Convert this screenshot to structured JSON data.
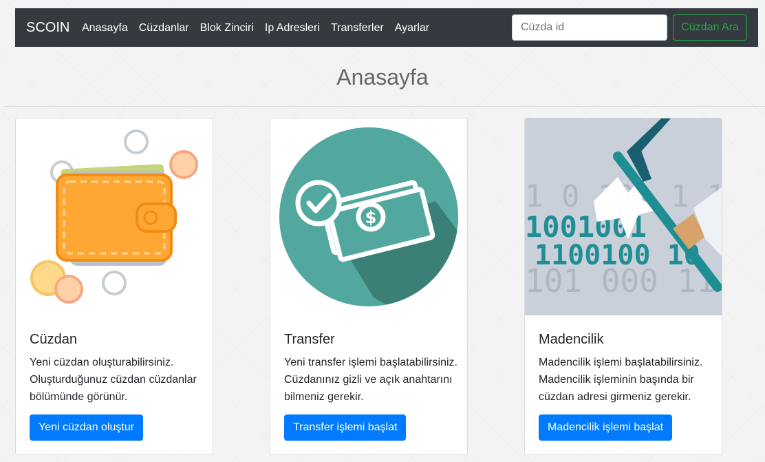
{
  "navbar": {
    "brand": "SCOIN",
    "links": [
      "Anasayfa",
      "Cüzdanlar",
      "Blok Zinciri",
      "Ip Adresleri",
      "Transferler",
      "Ayarlar"
    ],
    "search_placeholder": "Cüzda id",
    "search_button": "Cüzdan Ara"
  },
  "page_title": "Anasayfa",
  "cards": [
    {
      "icon": "wallet-illustration",
      "title": "Cüzdan",
      "text": "Yeni cüzdan oluşturabilirsiniz. Oluşturduğunuz cüzdan cüzdanlar bölümünde görünür.",
      "button": "Yeni cüzdan oluştur"
    },
    {
      "icon": "money-transfer-illustration",
      "title": "Transfer",
      "text": "Yeni transfer işlemi başlatabilirsiniz. Cüzdanınız gizli ve açık anahtarını bilmeniz gerekir.",
      "button": "Transfer işlemi başlat"
    },
    {
      "icon": "mining-pickaxe-illustration",
      "title": "Madencilik",
      "text": "Madencilik işlemi başlatabilirsiniz. Madencilik işleminin başında bir cüzdan adresi girmeniz gerekir.",
      "button": "Madencilik işlemi başlat",
      "binary_lines": [
        "1 0 101 1 1 1",
        "1001001",
        "1100100 10",
        "101 000 11"
      ]
    }
  ],
  "colors": {
    "navbar_bg": "#343a40",
    "primary": "#007bff",
    "success": "#28a745"
  }
}
